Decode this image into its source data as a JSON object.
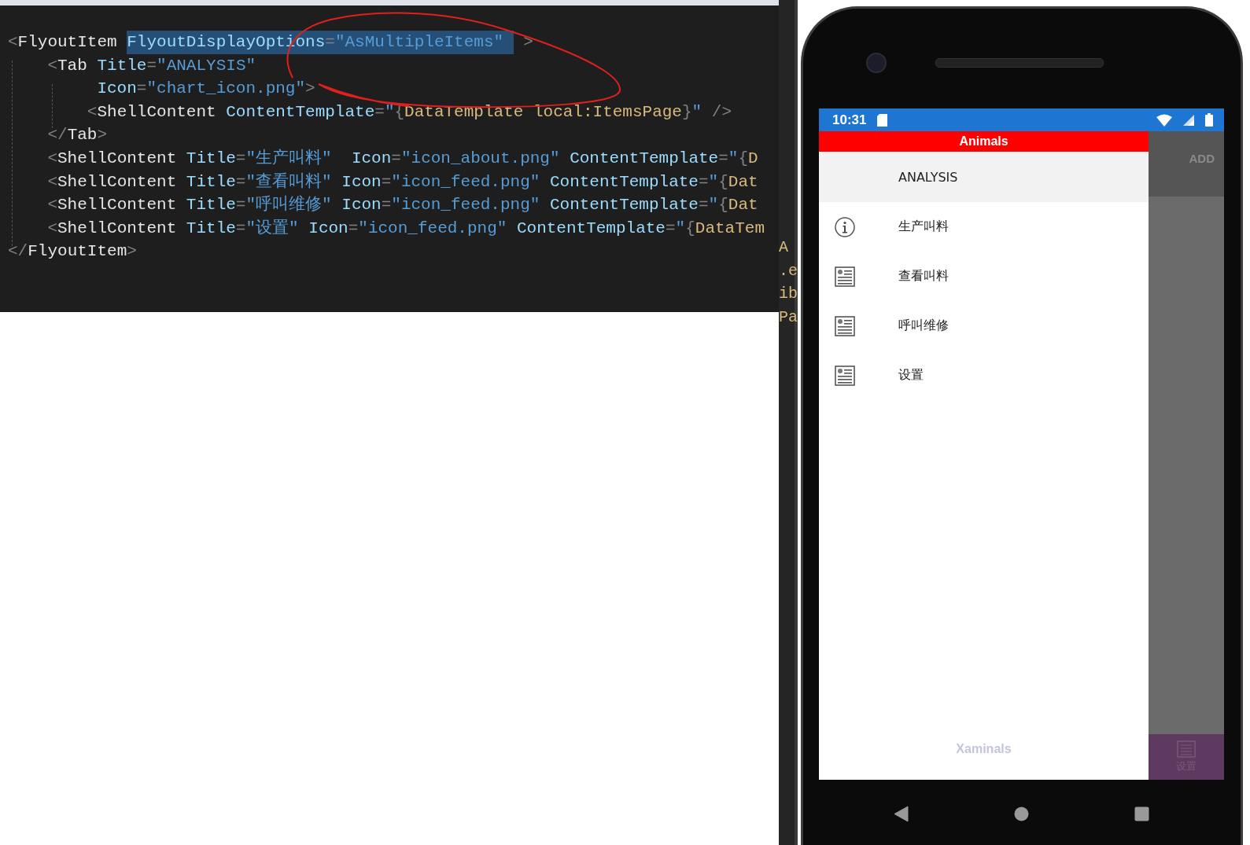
{
  "code_editor": {
    "lines": [
      {
        "tokens": [
          {
            "kind": "punct",
            "text": "<",
            "selected": false
          },
          {
            "kind": "tag",
            "text": "FlyoutItem ",
            "selected": false
          },
          {
            "kind": "attr",
            "text": "FlyoutDisplayOptions",
            "selected": true
          },
          {
            "kind": "punct",
            "text": "=",
            "selected": true
          },
          {
            "kind": "str",
            "text": "\"AsMultipleItems\" ",
            "selected": true
          },
          {
            "kind": "punct",
            "text": " >",
            "selected": false
          }
        ]
      },
      {
        "tokens": [
          {
            "kind": "punct",
            "text": "    <",
            "selected": false
          },
          {
            "kind": "tag",
            "text": "Tab ",
            "selected": false
          },
          {
            "kind": "attr",
            "text": "Title",
            "selected": false
          },
          {
            "kind": "punct",
            "text": "=",
            "selected": false
          },
          {
            "kind": "str",
            "text": "\"ANALYSIS\"",
            "selected": false
          }
        ]
      },
      {
        "tokens": [
          {
            "kind": "attr",
            "text": "         Icon",
            "selected": false
          },
          {
            "kind": "punct",
            "text": "=",
            "selected": false
          },
          {
            "kind": "str",
            "text": "\"chart_icon.png\"",
            "selected": false
          },
          {
            "kind": "punct",
            "text": ">",
            "selected": false
          }
        ]
      },
      {
        "tokens": [
          {
            "kind": "punct",
            "text": "        <",
            "selected": false
          },
          {
            "kind": "tag",
            "text": "ShellContent ",
            "selected": false
          },
          {
            "kind": "attr",
            "text": "ContentTemplate",
            "selected": false
          },
          {
            "kind": "punct",
            "text": "=",
            "selected": false
          },
          {
            "kind": "str",
            "text": "\"",
            "selected": false
          },
          {
            "kind": "punct",
            "text": "{",
            "selected": false
          },
          {
            "kind": "type",
            "text": "DataTemplate local:ItemsPage",
            "selected": false
          },
          {
            "kind": "punct",
            "text": "}",
            "selected": false
          },
          {
            "kind": "str",
            "text": "\"",
            "selected": false
          },
          {
            "kind": "punct",
            "text": " />",
            "selected": false
          }
        ]
      },
      {
        "tokens": [
          {
            "kind": "punct",
            "text": "    </",
            "selected": false
          },
          {
            "kind": "tag",
            "text": "Tab",
            "selected": false
          },
          {
            "kind": "punct",
            "text": ">",
            "selected": false
          }
        ]
      },
      {
        "tokens": [
          {
            "kind": "punct",
            "text": "    <",
            "selected": false
          },
          {
            "kind": "tag",
            "text": "ShellContent ",
            "selected": false
          },
          {
            "kind": "attr",
            "text": "Title",
            "selected": false
          },
          {
            "kind": "punct",
            "text": "=",
            "selected": false
          },
          {
            "kind": "str",
            "text": "\"生产叫料\"",
            "selected": false
          },
          {
            "kind": "attr",
            "text": "  Icon",
            "selected": false
          },
          {
            "kind": "punct",
            "text": "=",
            "selected": false
          },
          {
            "kind": "str",
            "text": "\"icon_about.png\"",
            "selected": false
          },
          {
            "kind": "attr",
            "text": " ContentTemplate",
            "selected": false
          },
          {
            "kind": "punct",
            "text": "=",
            "selected": false
          },
          {
            "kind": "str",
            "text": "\"",
            "selected": false
          },
          {
            "kind": "punct",
            "text": "{",
            "selected": false
          },
          {
            "kind": "type",
            "text": "D",
            "selected": false
          }
        ]
      },
      {
        "tokens": [
          {
            "kind": "punct",
            "text": "    <",
            "selected": false
          },
          {
            "kind": "tag",
            "text": "ShellContent ",
            "selected": false
          },
          {
            "kind": "attr",
            "text": "Title",
            "selected": false
          },
          {
            "kind": "punct",
            "text": "=",
            "selected": false
          },
          {
            "kind": "str",
            "text": "\"查看叫料\"",
            "selected": false
          },
          {
            "kind": "attr",
            "text": " Icon",
            "selected": false
          },
          {
            "kind": "punct",
            "text": "=",
            "selected": false
          },
          {
            "kind": "str",
            "text": "\"icon_feed.png\"",
            "selected": false
          },
          {
            "kind": "attr",
            "text": " ContentTemplate",
            "selected": false
          },
          {
            "kind": "punct",
            "text": "=",
            "selected": false
          },
          {
            "kind": "str",
            "text": "\"",
            "selected": false
          },
          {
            "kind": "punct",
            "text": "{",
            "selected": false
          },
          {
            "kind": "type",
            "text": "Dat",
            "selected": false
          }
        ]
      },
      {
        "tokens": [
          {
            "kind": "punct",
            "text": "    <",
            "selected": false
          },
          {
            "kind": "tag",
            "text": "ShellContent ",
            "selected": false
          },
          {
            "kind": "attr",
            "text": "Title",
            "selected": false
          },
          {
            "kind": "punct",
            "text": "=",
            "selected": false
          },
          {
            "kind": "str",
            "text": "\"呼叫维修\"",
            "selected": false
          },
          {
            "kind": "attr",
            "text": " Icon",
            "selected": false
          },
          {
            "kind": "punct",
            "text": "=",
            "selected": false
          },
          {
            "kind": "str",
            "text": "\"icon_feed.png\"",
            "selected": false
          },
          {
            "kind": "attr",
            "text": " ContentTemplate",
            "selected": false
          },
          {
            "kind": "punct",
            "text": "=",
            "selected": false
          },
          {
            "kind": "str",
            "text": "\"",
            "selected": false
          },
          {
            "kind": "punct",
            "text": "{",
            "selected": false
          },
          {
            "kind": "type",
            "text": "Dat",
            "selected": false
          }
        ]
      },
      {
        "tokens": [
          {
            "kind": "punct",
            "text": "    <",
            "selected": false
          },
          {
            "kind": "tag",
            "text": "ShellContent ",
            "selected": false
          },
          {
            "kind": "attr",
            "text": "Title",
            "selected": false
          },
          {
            "kind": "punct",
            "text": "=",
            "selected": false
          },
          {
            "kind": "str",
            "text": "\"设置\"",
            "selected": false
          },
          {
            "kind": "attr",
            "text": " Icon",
            "selected": false
          },
          {
            "kind": "punct",
            "text": "=",
            "selected": false
          },
          {
            "kind": "str",
            "text": "\"icon_feed.png\"",
            "selected": false
          },
          {
            "kind": "attr",
            "text": " ContentTemplate",
            "selected": false
          },
          {
            "kind": "punct",
            "text": "=",
            "selected": false
          },
          {
            "kind": "str",
            "text": "\"",
            "selected": false
          },
          {
            "kind": "punct",
            "text": "{",
            "selected": false
          },
          {
            "kind": "type",
            "text": "DataTem",
            "selected": false
          }
        ]
      },
      {
        "tokens": [
          {
            "kind": "punct",
            "text": "</",
            "selected": false
          },
          {
            "kind": "tag",
            "text": "FlyoutItem",
            "selected": false
          },
          {
            "kind": "punct",
            "text": ">",
            "selected": false
          }
        ]
      }
    ]
  },
  "side_strip": {
    "fragments": [
      "A",
      ".e",
      "ib",
      "Pa"
    ]
  },
  "phone": {
    "status_bar": {
      "time": "10:31"
    },
    "flyout": {
      "header": "Animals",
      "items": [
        {
          "kind": "plain",
          "label": "ANALYSIS",
          "selected": true
        },
        {
          "kind": "info",
          "label": "生产叫料",
          "selected": false
        },
        {
          "kind": "page",
          "label": "查看叫料",
          "selected": false
        },
        {
          "kind": "page",
          "label": "呼叫维修",
          "selected": false
        },
        {
          "kind": "page",
          "label": "设置",
          "selected": false
        }
      ],
      "footer": "Xaminals"
    },
    "toolbar": {
      "action": "ADD"
    },
    "bottom_tab": {
      "label": "设置"
    }
  }
}
